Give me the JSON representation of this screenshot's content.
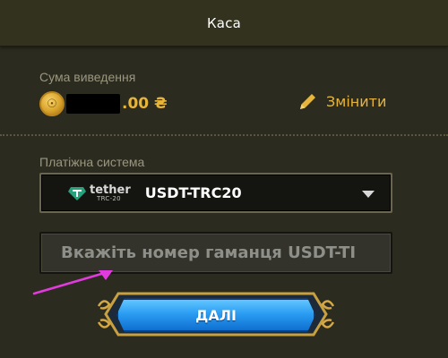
{
  "header": {
    "title": "Каса"
  },
  "withdrawal": {
    "amount_label": "Сума виведення",
    "amount_value": ".00 ₴",
    "change_label": "Змінити"
  },
  "payment": {
    "system_label": "Платіжна система",
    "logo_name": "tether",
    "logo_sub": "TRC-20",
    "selected": "USDT-TRC20"
  },
  "wallet": {
    "placeholder": "Вкажіть номер гаманця USDT-TI",
    "value": ""
  },
  "next_button": {
    "label": "ДАЛІ"
  },
  "colors": {
    "background": "#2c2b1f",
    "accent_gold": "#e7b53a",
    "button_blue": "#2b9df3",
    "annotation_arrow": "#e03bdc"
  },
  "icons": {
    "coin": "coin-icon",
    "edit": "pencil-icon",
    "tether": "tether-logo-icon",
    "dropdown": "chevron-down-icon"
  }
}
